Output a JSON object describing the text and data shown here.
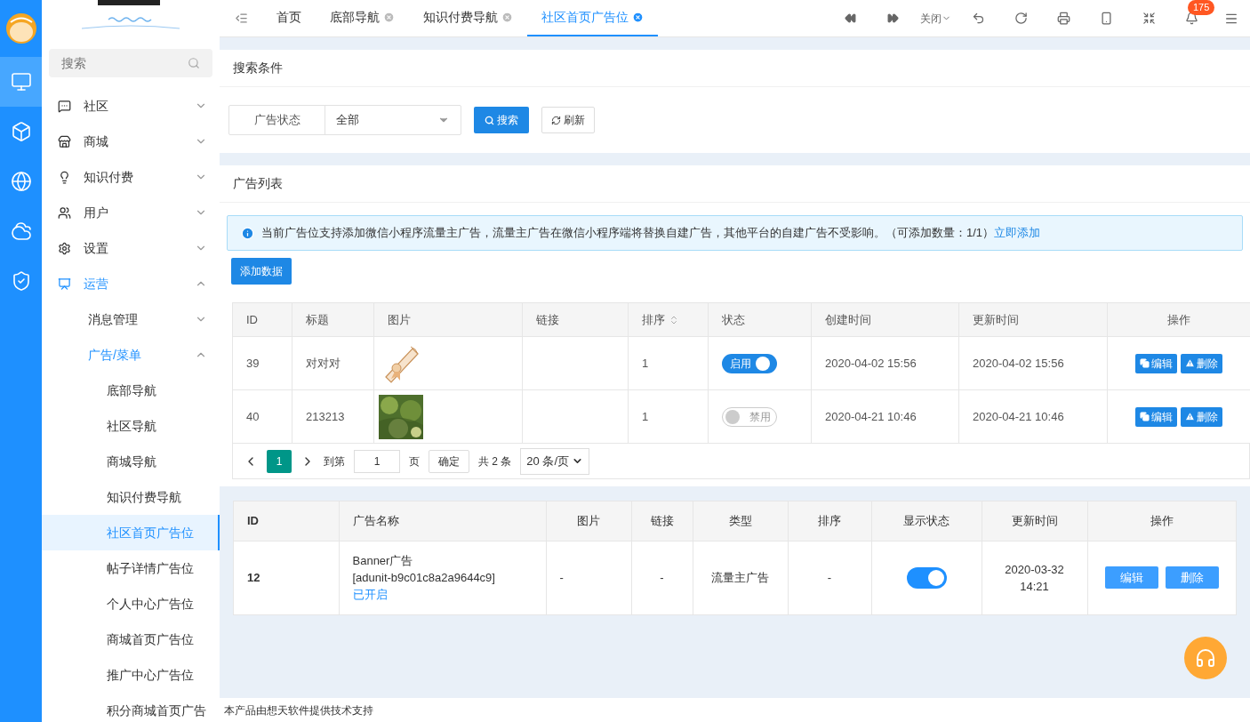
{
  "rail": [
    {
      "selected": false
    },
    {
      "selected": true
    },
    {
      "selected": false
    },
    {
      "selected": false
    },
    {
      "selected": false
    },
    {
      "selected": false
    }
  ],
  "sidebar": {
    "search": {
      "placeholder": "搜索"
    },
    "menu": [
      {
        "label": "社区",
        "expanded": false,
        "selected": false
      },
      {
        "label": "商城",
        "expanded": false,
        "selected": false
      },
      {
        "label": "知识付费",
        "expanded": false,
        "selected": false
      },
      {
        "label": "用户",
        "expanded": false,
        "selected": false
      },
      {
        "label": "设置",
        "expanded": false,
        "selected": false
      },
      {
        "label": "运营",
        "expanded": true,
        "selected": true,
        "children": [
          {
            "label": "消息管理",
            "expanded": false,
            "selected": false
          },
          {
            "label": "广告/菜单",
            "expanded": true,
            "selected": true,
            "children": [
              {
                "label": "底部导航",
                "selected": false
              },
              {
                "label": "社区导航",
                "selected": false
              },
              {
                "label": "商城导航",
                "selected": false
              },
              {
                "label": "知识付费导航",
                "selected": false
              },
              {
                "label": "社区首页广告位",
                "selected": true
              },
              {
                "label": "帖子详情广告位",
                "selected": false
              },
              {
                "label": "个人中心广告位",
                "selected": false
              },
              {
                "label": "商城首页广告位",
                "selected": false
              },
              {
                "label": "推广中心广告位",
                "selected": false
              },
              {
                "label": "积分商城首页广告",
                "selected": false
              }
            ]
          }
        ]
      }
    ]
  },
  "tabs": [
    {
      "label": "首页",
      "closable": false,
      "selected": false
    },
    {
      "label": "底部导航",
      "closable": true,
      "selected": false
    },
    {
      "label": "知识付费导航",
      "closable": true,
      "selected": false
    },
    {
      "label": "社区首页广告位",
      "closable": true,
      "selected": true
    }
  ],
  "toolbar": {
    "close_menu": "关闭",
    "badge": "175"
  },
  "search_panel": {
    "title": "搜索条件",
    "filter": {
      "label": "广告状态",
      "value": "全部"
    },
    "buttons": [
      "搜索",
      "刷新"
    ]
  },
  "list_panel": {
    "title": "广告列表",
    "notice": {
      "text": "当前广告位支持添加微信小程序流量主广告，流量主广告在微信小程序端将替换自建广告，其他平台的自建广告不受影响。（可添加数量：1/1）",
      "link": "立即添加"
    },
    "add_button": "添加数据",
    "table": {
      "columns": [
        "ID",
        "标题",
        "图片",
        "链接",
        "排序",
        "状态",
        "创建时间",
        "更新时间",
        "操作"
      ],
      "rows": [
        {
          "id": "39",
          "title": "对对对",
          "link": "",
          "sort": "1",
          "status": {
            "on": true,
            "label": "启用"
          },
          "created": "2020-04-02 15:56",
          "updated": "2020-04-02 15:56",
          "actions": [
            "编辑",
            "删除"
          ]
        },
        {
          "id": "40",
          "title": "213213",
          "link": "",
          "sort": "1",
          "status": {
            "on": false,
            "label": "禁用"
          },
          "created": "2020-04-21 10:46",
          "updated": "2020-04-21 10:46",
          "actions": [
            "编辑",
            "删除"
          ]
        }
      ]
    },
    "pagination": {
      "pages": [
        {
          "label": "1",
          "selected": true
        }
      ],
      "goto_label": "到第",
      "goto_value": "1",
      "page_unit": "页",
      "confirm": "确定",
      "total": "共 2 条",
      "page_size": "20 条/页"
    }
  },
  "flow_table": {
    "columns": [
      "ID",
      "广告名称",
      "图片",
      "链接",
      "类型",
      "排序",
      "显示状态",
      "更新时间",
      "操作"
    ],
    "rows": [
      {
        "id": "12",
        "name": "Banner广告",
        "unit": "[adunit-b9c01c8a2a9644c9]",
        "state": "已开启",
        "image": "-",
        "link": "-",
        "type": "流量主广告",
        "sort": "-",
        "on": true,
        "updated_date": "2020-03-32",
        "updated_time": "14:21",
        "actions": [
          "编辑",
          "删除"
        ]
      }
    ]
  },
  "footer": "本产品由想天软件提供技术支持"
}
